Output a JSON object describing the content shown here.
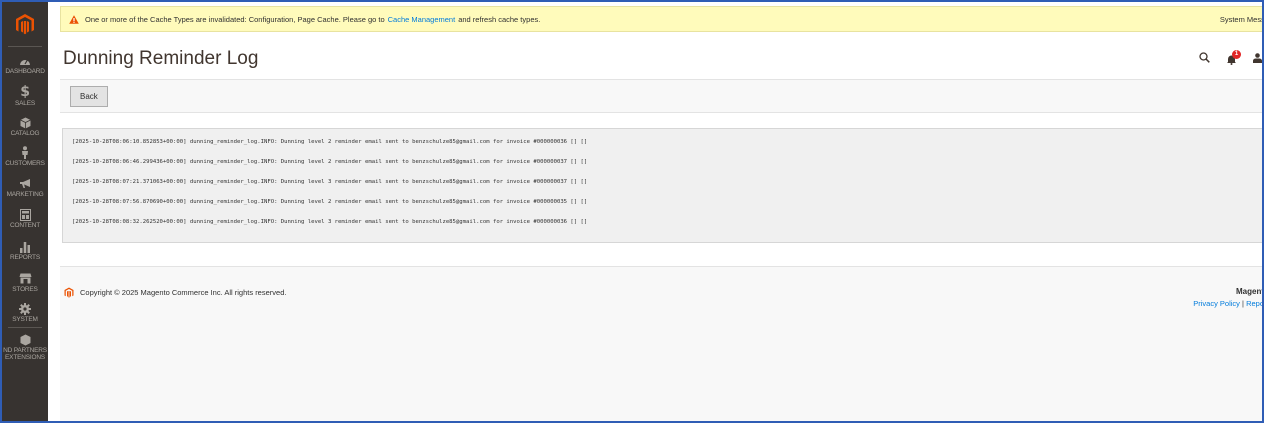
{
  "sidebar": {
    "items": [
      {
        "label": "DASHBOARD",
        "icon": "dashboard-icon"
      },
      {
        "label": "SALES",
        "icon": "dollar-icon"
      },
      {
        "label": "CATALOG",
        "icon": "cube-icon"
      },
      {
        "label": "CUSTOMERS",
        "icon": "person-icon"
      },
      {
        "label": "MARKETING",
        "icon": "megaphone-icon"
      },
      {
        "label": "CONTENT",
        "icon": "layout-icon"
      },
      {
        "label": "REPORTS",
        "icon": "bar-chart-icon"
      },
      {
        "label": "STORES",
        "icon": "storefront-icon"
      },
      {
        "label": "SYSTEM",
        "icon": "gear-icon"
      },
      {
        "label": "ND PARTNERS",
        "label2": "EXTENSIONS",
        "icon": "hexagon-icon"
      }
    ]
  },
  "system_message": {
    "text_before": "One or more of the Cache Types are invalidated: Configuration, Page Cache. Please go to",
    "link": "Cache Management",
    "text_after": "and refresh cache types.",
    "right_label": "System Messa"
  },
  "header": {
    "title": "Dunning Reminder Log",
    "notification_count": "1"
  },
  "actions": {
    "back_label": "Back"
  },
  "log": {
    "lines": [
      "[2025-10-28T08:06:10.852853+00:00] dunning_reminder_log.INFO: Dunning level 2 reminder email sent to benzschulze85@gmail.com for invoice #000000036 [] []",
      "[2025-10-28T08:06:46.299436+00:00] dunning_reminder_log.INFO: Dunning level 2 reminder email sent to benzschulze85@gmail.com for invoice #000000037 [] []",
      "[2025-10-28T08:07:21.371063+00:00] dunning_reminder_log.INFO: Dunning level 3 reminder email sent to benzschulze85@gmail.com for invoice #000000037 [] []",
      "[2025-10-28T08:07:56.870690+00:00] dunning_reminder_log.INFO: Dunning level 2 reminder email sent to benzschulze85@gmail.com for invoice #000000035 [] []",
      "[2025-10-28T08:08:32.262520+00:00] dunning_reminder_log.INFO: Dunning level 3 reminder email sent to benzschulze85@gmail.com for invoice #000000036 [] []"
    ]
  },
  "footer": {
    "copyright": "Copyright © 2025 Magento Commerce Inc. All rights reserved.",
    "brand": "Magent",
    "privacy_link": "Privacy Policy",
    "separator": "|",
    "report_link": "Repo"
  },
  "colors": {
    "sidebar_bg": "#373330",
    "accent_orange": "#eb5202",
    "link_blue": "#007bdb",
    "message_bg": "#fffbbb",
    "badge_red": "#e22626"
  }
}
